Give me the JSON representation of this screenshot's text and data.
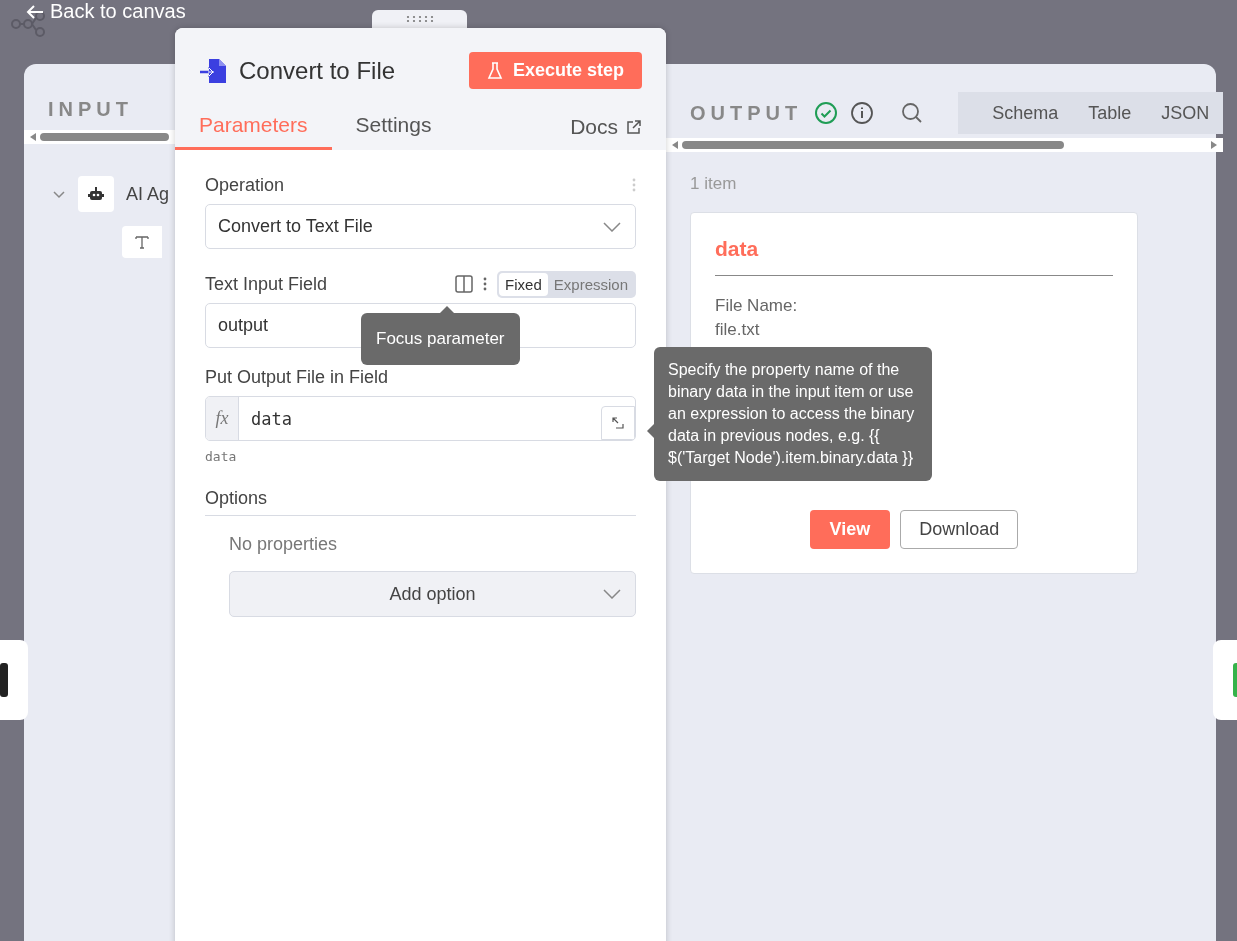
{
  "header": {
    "back_label": "Back to canvas"
  },
  "input_pane": {
    "title": "INPUT",
    "tree": [
      {
        "label": "AI Ag",
        "expanded": true
      }
    ]
  },
  "node_panel": {
    "title": "Convert to File",
    "execute_button": "Execute step",
    "tabs": [
      {
        "label": "Parameters",
        "selected": true
      },
      {
        "label": "Settings",
        "selected": false
      }
    ],
    "docs_link": "Docs",
    "operation": {
      "label": "Operation",
      "value": "Convert to Text File"
    },
    "text_input_field": {
      "label": "Text Input Field",
      "value": "output",
      "modes": [
        {
          "label": "Fixed",
          "selected": true
        },
        {
          "label": "Expression",
          "selected": false
        }
      ]
    },
    "output_field": {
      "label": "Put Output File in Field",
      "value": "data",
      "expression": true,
      "expression_mark": "fx",
      "hint": "data"
    },
    "options": {
      "label": "Options",
      "empty_text": "No properties",
      "add_button": "Add option"
    }
  },
  "tooltips": {
    "focus": "Focus parameter",
    "help": "Specify the property name of the binary data in the input item or use an expression to access the binary data in previous nodes, e.g. {{ $('Target Node').item.binary.data }}"
  },
  "output_pane": {
    "title": "OUTPUT",
    "success": true,
    "tabs": [
      {
        "label": "Schema",
        "selected": false
      },
      {
        "label": "Table",
        "selected": false
      },
      {
        "label": "JSON",
        "selected": false
      }
    ],
    "count": "1 item",
    "card": {
      "title": "data",
      "fields": [
        {
          "label": "File Name:",
          "value": "file.txt"
        }
      ],
      "view_button": "View",
      "download_button": "Download"
    }
  }
}
